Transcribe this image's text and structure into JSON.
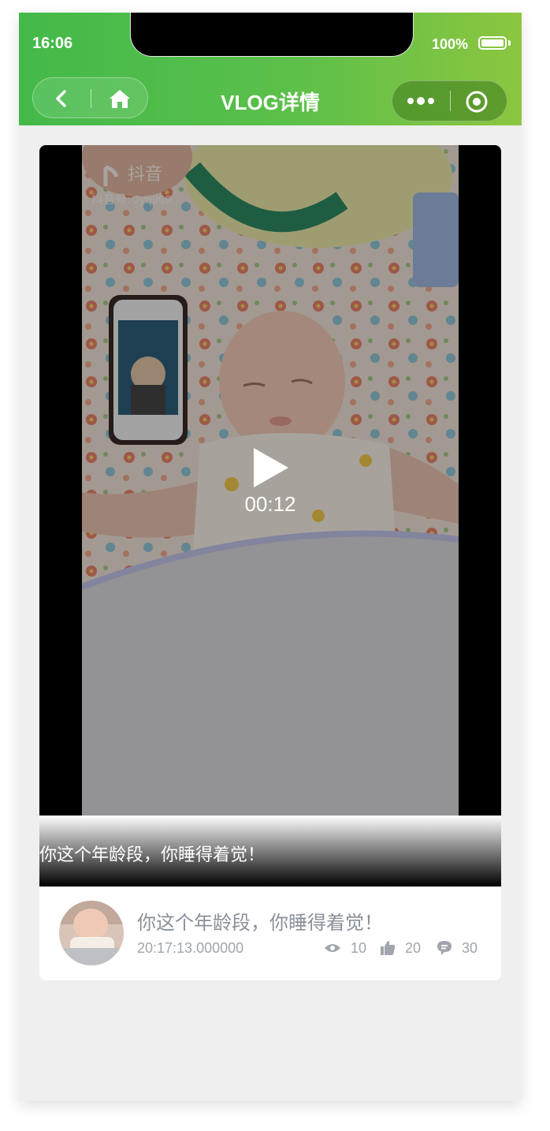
{
  "status_bar": {
    "time": "16:06",
    "battery": "100%"
  },
  "nav": {
    "title": "VLOG详情"
  },
  "video": {
    "duration": "00:12",
    "caption": "你这个年龄段，你睡得着觉！",
    "watermark": {
      "app": "抖音",
      "account": "抖音号: Jyq999."
    }
  },
  "post": {
    "title": "你这个年龄段，你睡得着觉！",
    "time": "20:17:13.000000",
    "views": "10",
    "likes": "20",
    "comments": "30"
  },
  "colors": {
    "header_start": "#43b94a",
    "header_end": "#8cc63f"
  },
  "icons": [
    "back-icon",
    "home-icon",
    "more-dots-icon",
    "target-icon",
    "play-icon",
    "eye-icon",
    "thumb-up-icon",
    "comment-icon"
  ]
}
